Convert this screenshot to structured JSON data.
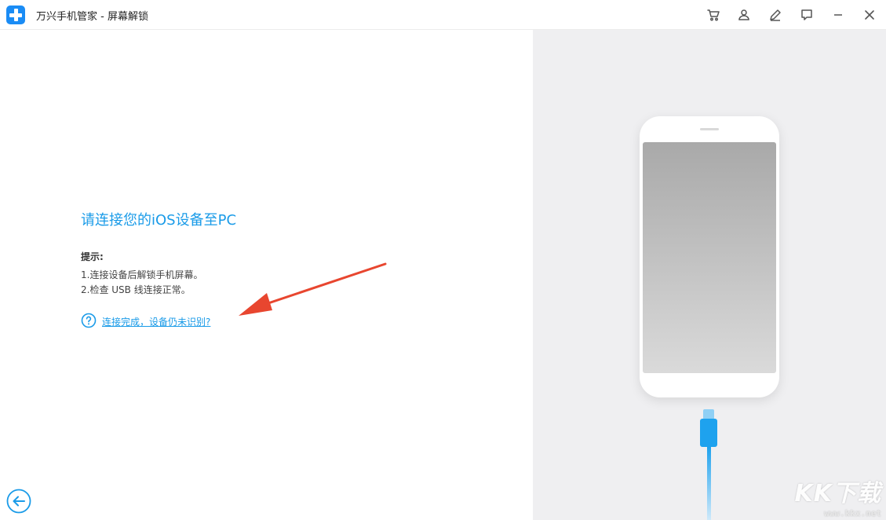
{
  "window": {
    "title": "万兴手机管家 - 屏幕解锁",
    "logo_icon": "plus-logo-icon",
    "toolbar_icons": [
      "cart-icon",
      "user-icon",
      "edit-icon",
      "feedback-icon",
      "minimize-icon",
      "close-icon"
    ]
  },
  "main": {
    "heading": "请连接您的iOS设备至PC",
    "tips_title": "提示:",
    "tips": [
      "1.连接设备后解锁手机屏幕。",
      "2.检查 USB 线连接正常。"
    ],
    "help_link": "连接完成，设备仍未识别?",
    "back_icon": "arrow-left-circle-icon"
  },
  "watermark": {
    "logo": "KK下载",
    "url": "www.kkx.net"
  },
  "colors": {
    "accent": "#1a9be8",
    "arrow": "#e8462f",
    "right_panel_bg": "#efeff1"
  }
}
